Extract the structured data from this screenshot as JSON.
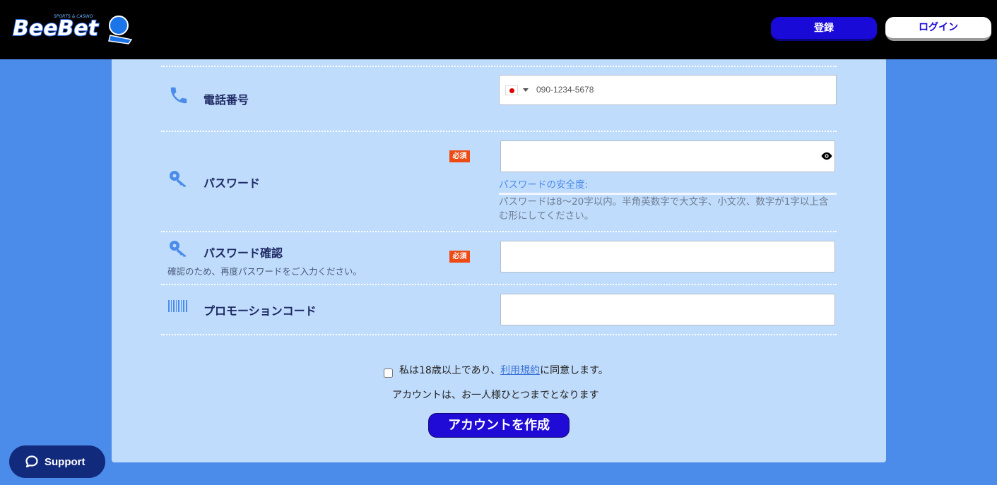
{
  "header": {
    "logo_text": "BeeBet",
    "logo_sub": "SPORTS & CASINO",
    "register_label": "登録",
    "login_label": "ログイン"
  },
  "form": {
    "phone": {
      "label": "電話番号",
      "placeholder": "090-1234-5678",
      "country": "JP"
    },
    "password": {
      "label": "パスワード",
      "required": "必須",
      "strength_label": "パスワードの安全度:",
      "hint": "パスワードは8〜20字以内。半角英数字で大文字、小文次、数字が1字以上含む形にしてください。"
    },
    "password_confirm": {
      "label": "パスワード確認",
      "sublabel": "確認のため、再度パスワードをご入力ください。",
      "required": "必須"
    },
    "promo": {
      "label": "プロモーションコード"
    }
  },
  "agreement": {
    "prefix": "私は18歳以上であり、",
    "terms_link": "利用規約",
    "suffix": "に同意します。",
    "note": "アカウントは、お一人様ひとつまでとなります",
    "create_button": "アカウントを作成"
  },
  "support": {
    "label": "Support"
  },
  "colors": {
    "accent": "#1a0ad8",
    "panel": "#c0dcfc",
    "background": "#4b8bea",
    "required": "#ee4a14"
  }
}
